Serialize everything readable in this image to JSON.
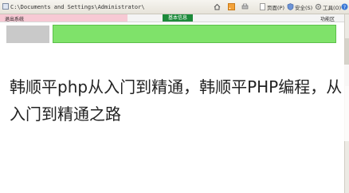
{
  "browser": {
    "address": "C:\\Documents and Settings\\Administrator\\",
    "toolbar": [
      {
        "icon": "home-icon"
      },
      {
        "icon": "feed-icon"
      },
      {
        "icon": "print-icon"
      },
      {
        "label": "页面(P)",
        "icon": "page-icon"
      },
      {
        "label": "安全(S)",
        "icon": "safety-icon"
      },
      {
        "label": "工具(O)",
        "icon": "tools-icon"
      },
      {
        "icon": "help-icon"
      }
    ]
  },
  "page": {
    "menu_left": "退出系统",
    "tab_active": "基本信息",
    "menu_right": "功能区"
  },
  "caption": "韩顺平php从入门到精通，韩顺平PHP编程，从入门到精通之路",
  "colors": {
    "accent_green": "#7fe26a",
    "tab_green": "#1c8a3a",
    "pink": "#f7c9d4"
  }
}
